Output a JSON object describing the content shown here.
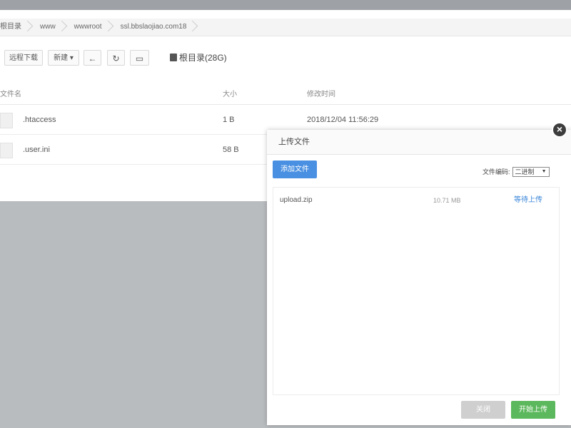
{
  "breadcrumb": [
    "根目录",
    "www",
    "wwwroot",
    "ssl.bbslaojiao.com18"
  ],
  "toolbar": {
    "remote_download": "远程下载",
    "new": "新建",
    "back_icon": "back-arrow-icon",
    "refresh_icon": "refresh-icon",
    "terminal_icon": "terminal-icon",
    "disk_label": "根目录(28G)"
  },
  "table": {
    "headers": [
      "文件名",
      "大小",
      "修改时间"
    ],
    "rows": [
      {
        "name": ".htaccess",
        "size": "1 B",
        "time": "2018/12/04 11:56:29"
      },
      {
        "name": ".user.ini",
        "size": "58 B",
        "time": ""
      }
    ]
  },
  "dialog": {
    "title": "上传文件",
    "add_file": "添加文件",
    "encoding_label": "文件编码:",
    "encoding_value": "二进制",
    "files": [
      {
        "name": "upload.zip",
        "size": "10.71 MB",
        "action": "等待上传"
      }
    ],
    "close_label": "关闭",
    "start_label": "开始上传"
  },
  "colors": {
    "primary_blue": "#4a90e2",
    "start_green": "#5cb85c",
    "close_gray": "#cfcfcf",
    "overlay": "#b9bcbf"
  }
}
